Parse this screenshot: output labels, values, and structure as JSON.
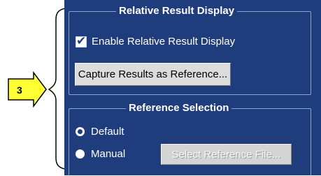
{
  "relative_result_display": {
    "title": "Relative Result Display",
    "enable_checkbox_label": "Enable Relative Result Display",
    "enable_checked": true,
    "capture_button_label": "Capture Results as Reference..."
  },
  "reference_selection": {
    "title": "Reference Selection",
    "options": [
      {
        "label": "Default",
        "selected": true
      },
      {
        "label": "Manual",
        "selected": false
      }
    ],
    "select_button_label": "Select Reference File..."
  },
  "callout": {
    "number": "3",
    "color": "#ffff33"
  },
  "colors": {
    "panel_background": "#1f3d7c",
    "text": "#ffffff"
  }
}
